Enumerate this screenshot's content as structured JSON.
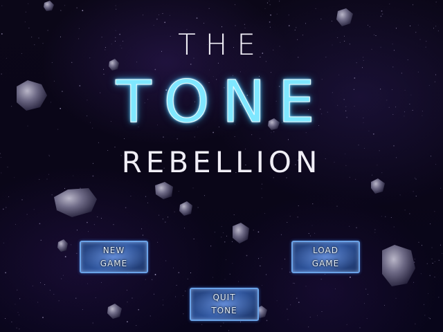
{
  "title": {
    "line1": "THE",
    "line2": "TONE",
    "line3": "REBELLION"
  },
  "menu": {
    "new_game": [
      "NEW",
      "GAME"
    ],
    "load_game": [
      "LOAD",
      "GAME"
    ],
    "quit": [
      "QUIT",
      "TONE"
    ]
  },
  "colors": {
    "background": "#0a0618",
    "title_accent": "#7fe7ff",
    "title_text": "#f0eef6",
    "button_border": "#6aa3e8",
    "button_fill": "#2f57a1"
  }
}
